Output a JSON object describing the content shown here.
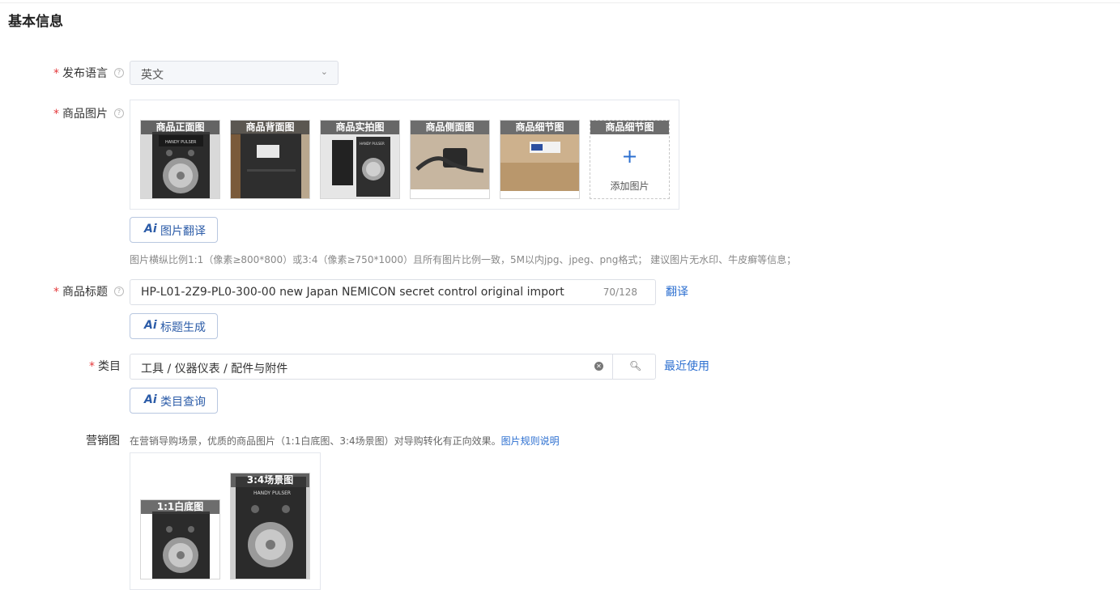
{
  "section": {
    "title": "基本信息"
  },
  "language": {
    "label": "发布语言",
    "value": "英文"
  },
  "images": {
    "label": "商品图片",
    "slots": [
      {
        "caption": "商品正面图",
        "photo": "HANDY PULSER"
      },
      {
        "caption": "商品背面图",
        "photo": ""
      },
      {
        "caption": "商品实拍图",
        "photo": "HANDY PULSER"
      },
      {
        "caption": "商品侧面图",
        "photo": ""
      },
      {
        "caption": "商品细节图",
        "photo": ""
      }
    ],
    "add_slot": {
      "caption": "商品细节图",
      "plus": "+",
      "label": "添加图片"
    },
    "ai_button": "图片翻译",
    "hint": "图片横纵比例1:1（像素≥800*800）或3:4（像素≥750*1000）且所有图片比例一致，5M以内jpg、jpeg、png格式； 建议图片无水印、牛皮癣等信息；"
  },
  "title": {
    "label": "商品标题",
    "value": "HP-L01-2Z9-PL0-300-00 new Japan NEMICON secret control original import",
    "counter": "70/128",
    "translate": "翻译",
    "ai_button": "标题生成"
  },
  "category": {
    "label": "类目",
    "value": "工具 / 仪器仪表 / 配件与附件",
    "recent": "最近使用",
    "ai_button": "类目查询"
  },
  "marketing": {
    "label": "营销图",
    "hint": "在营销导购场景，优质的商品图片（1:1白底图、3:4场景图）对导购转化有正向效果。",
    "hint_link": "图片规则说明",
    "slots": [
      {
        "caption": "1:1白底图"
      },
      {
        "caption": "3:4场景图",
        "photo": "HANDY PULSER"
      }
    ]
  },
  "ai_mark": "Ai",
  "icons": {
    "help": "help-circle-icon",
    "chevron": "chevron-down-icon",
    "search": "search-icon",
    "clear": "clear-icon"
  }
}
